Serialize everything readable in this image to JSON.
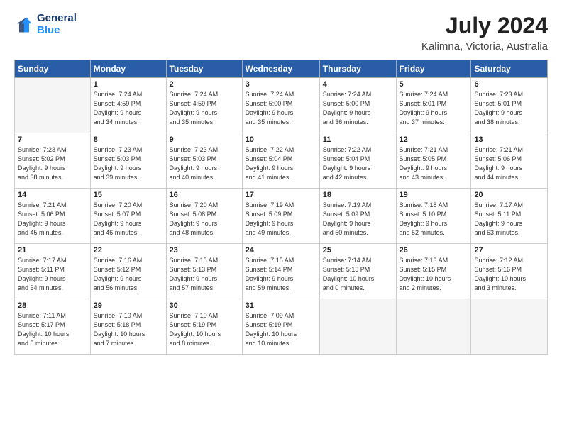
{
  "logo": {
    "line1": "General",
    "line2": "Blue"
  },
  "title": "July 2024",
  "subtitle": "Kalimna, Victoria, Australia",
  "headers": [
    "Sunday",
    "Monday",
    "Tuesday",
    "Wednesday",
    "Thursday",
    "Friday",
    "Saturday"
  ],
  "weeks": [
    [
      {
        "day": "",
        "info": ""
      },
      {
        "day": "1",
        "info": "Sunrise: 7:24 AM\nSunset: 4:59 PM\nDaylight: 9 hours\nand 34 minutes."
      },
      {
        "day": "2",
        "info": "Sunrise: 7:24 AM\nSunset: 4:59 PM\nDaylight: 9 hours\nand 35 minutes."
      },
      {
        "day": "3",
        "info": "Sunrise: 7:24 AM\nSunset: 5:00 PM\nDaylight: 9 hours\nand 35 minutes."
      },
      {
        "day": "4",
        "info": "Sunrise: 7:24 AM\nSunset: 5:00 PM\nDaylight: 9 hours\nand 36 minutes."
      },
      {
        "day": "5",
        "info": "Sunrise: 7:24 AM\nSunset: 5:01 PM\nDaylight: 9 hours\nand 37 minutes."
      },
      {
        "day": "6",
        "info": "Sunrise: 7:23 AM\nSunset: 5:01 PM\nDaylight: 9 hours\nand 38 minutes."
      }
    ],
    [
      {
        "day": "7",
        "info": "Sunrise: 7:23 AM\nSunset: 5:02 PM\nDaylight: 9 hours\nand 38 minutes."
      },
      {
        "day": "8",
        "info": "Sunrise: 7:23 AM\nSunset: 5:03 PM\nDaylight: 9 hours\nand 39 minutes."
      },
      {
        "day": "9",
        "info": "Sunrise: 7:23 AM\nSunset: 5:03 PM\nDaylight: 9 hours\nand 40 minutes."
      },
      {
        "day": "10",
        "info": "Sunrise: 7:22 AM\nSunset: 5:04 PM\nDaylight: 9 hours\nand 41 minutes."
      },
      {
        "day": "11",
        "info": "Sunrise: 7:22 AM\nSunset: 5:04 PM\nDaylight: 9 hours\nand 42 minutes."
      },
      {
        "day": "12",
        "info": "Sunrise: 7:21 AM\nSunset: 5:05 PM\nDaylight: 9 hours\nand 43 minutes."
      },
      {
        "day": "13",
        "info": "Sunrise: 7:21 AM\nSunset: 5:06 PM\nDaylight: 9 hours\nand 44 minutes."
      }
    ],
    [
      {
        "day": "14",
        "info": "Sunrise: 7:21 AM\nSunset: 5:06 PM\nDaylight: 9 hours\nand 45 minutes."
      },
      {
        "day": "15",
        "info": "Sunrise: 7:20 AM\nSunset: 5:07 PM\nDaylight: 9 hours\nand 46 minutes."
      },
      {
        "day": "16",
        "info": "Sunrise: 7:20 AM\nSunset: 5:08 PM\nDaylight: 9 hours\nand 48 minutes."
      },
      {
        "day": "17",
        "info": "Sunrise: 7:19 AM\nSunset: 5:09 PM\nDaylight: 9 hours\nand 49 minutes."
      },
      {
        "day": "18",
        "info": "Sunrise: 7:19 AM\nSunset: 5:09 PM\nDaylight: 9 hours\nand 50 minutes."
      },
      {
        "day": "19",
        "info": "Sunrise: 7:18 AM\nSunset: 5:10 PM\nDaylight: 9 hours\nand 52 minutes."
      },
      {
        "day": "20",
        "info": "Sunrise: 7:17 AM\nSunset: 5:11 PM\nDaylight: 9 hours\nand 53 minutes."
      }
    ],
    [
      {
        "day": "21",
        "info": "Sunrise: 7:17 AM\nSunset: 5:11 PM\nDaylight: 9 hours\nand 54 minutes."
      },
      {
        "day": "22",
        "info": "Sunrise: 7:16 AM\nSunset: 5:12 PM\nDaylight: 9 hours\nand 56 minutes."
      },
      {
        "day": "23",
        "info": "Sunrise: 7:15 AM\nSunset: 5:13 PM\nDaylight: 9 hours\nand 57 minutes."
      },
      {
        "day": "24",
        "info": "Sunrise: 7:15 AM\nSunset: 5:14 PM\nDaylight: 9 hours\nand 59 minutes."
      },
      {
        "day": "25",
        "info": "Sunrise: 7:14 AM\nSunset: 5:15 PM\nDaylight: 10 hours\nand 0 minutes."
      },
      {
        "day": "26",
        "info": "Sunrise: 7:13 AM\nSunset: 5:15 PM\nDaylight: 10 hours\nand 2 minutes."
      },
      {
        "day": "27",
        "info": "Sunrise: 7:12 AM\nSunset: 5:16 PM\nDaylight: 10 hours\nand 3 minutes."
      }
    ],
    [
      {
        "day": "28",
        "info": "Sunrise: 7:11 AM\nSunset: 5:17 PM\nDaylight: 10 hours\nand 5 minutes."
      },
      {
        "day": "29",
        "info": "Sunrise: 7:10 AM\nSunset: 5:18 PM\nDaylight: 10 hours\nand 7 minutes."
      },
      {
        "day": "30",
        "info": "Sunrise: 7:10 AM\nSunset: 5:19 PM\nDaylight: 10 hours\nand 8 minutes."
      },
      {
        "day": "31",
        "info": "Sunrise: 7:09 AM\nSunset: 5:19 PM\nDaylight: 10 hours\nand 10 minutes."
      },
      {
        "day": "",
        "info": ""
      },
      {
        "day": "",
        "info": ""
      },
      {
        "day": "",
        "info": ""
      }
    ]
  ]
}
